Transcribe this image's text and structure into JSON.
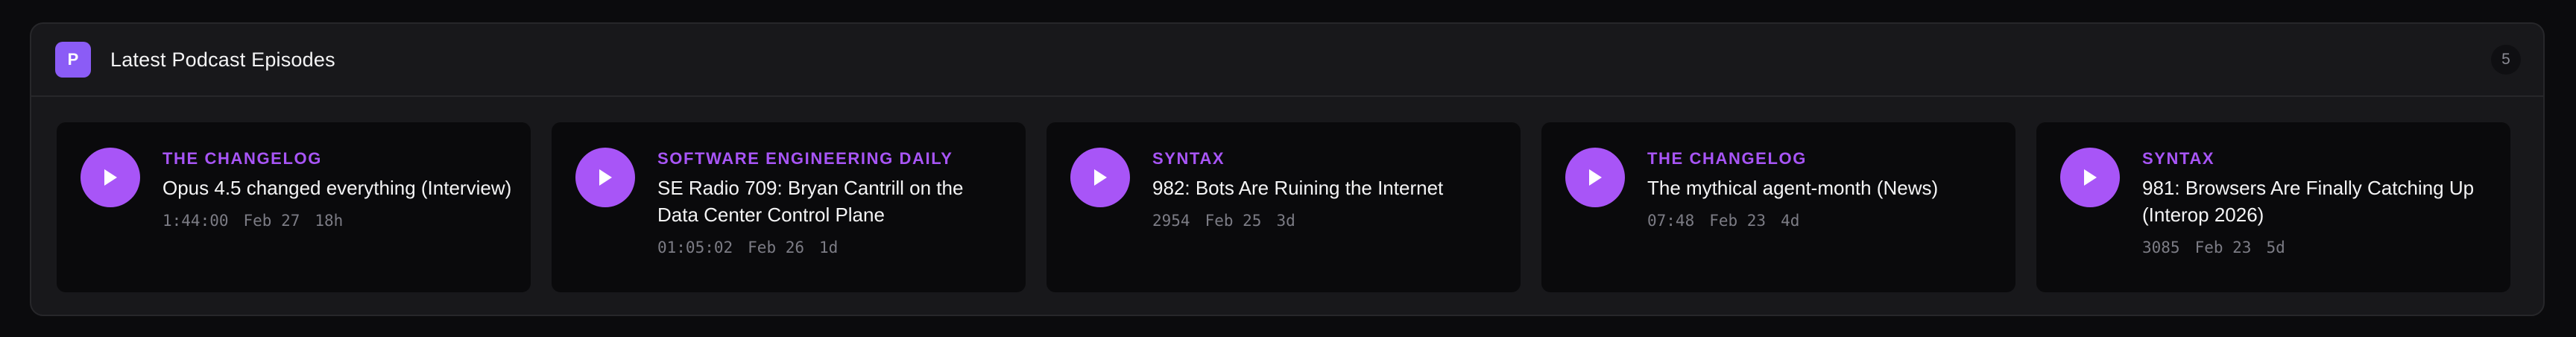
{
  "header": {
    "logo_letter": "P",
    "title": "Latest Podcast Episodes",
    "count": "5"
  },
  "colors": {
    "accent": "#a855f7",
    "logo_bg": "#8b5cf6",
    "panel_bg": "#18181b",
    "card_bg": "#0a0a0c"
  },
  "episodes": [
    {
      "show": "THE CHANGELOG",
      "title": "Opus 4.5 changed everything (Interview)",
      "duration": "1:44:00",
      "date": "Feb 27",
      "age": "18h",
      "icon": "play-icon"
    },
    {
      "show": "SOFTWARE ENGINEERING DAILY",
      "title": "SE Radio 709: Bryan Cantrill on the Data Center Control Plane",
      "duration": "01:05:02",
      "date": "Feb 26",
      "age": "1d",
      "icon": "play-icon"
    },
    {
      "show": "SYNTAX",
      "title": "982: Bots Are Ruining the Internet",
      "duration": "2954",
      "date": "Feb 25",
      "age": "3d",
      "icon": "play-icon"
    },
    {
      "show": "THE CHANGELOG",
      "title": "The mythical agent-month (News)",
      "duration": "07:48",
      "date": "Feb 23",
      "age": "4d",
      "icon": "play-icon"
    },
    {
      "show": "SYNTAX",
      "title": "981: Browsers Are Finally Catching Up (Interop 2026)",
      "duration": "3085",
      "date": "Feb 23",
      "age": "5d",
      "icon": "play-icon"
    }
  ]
}
